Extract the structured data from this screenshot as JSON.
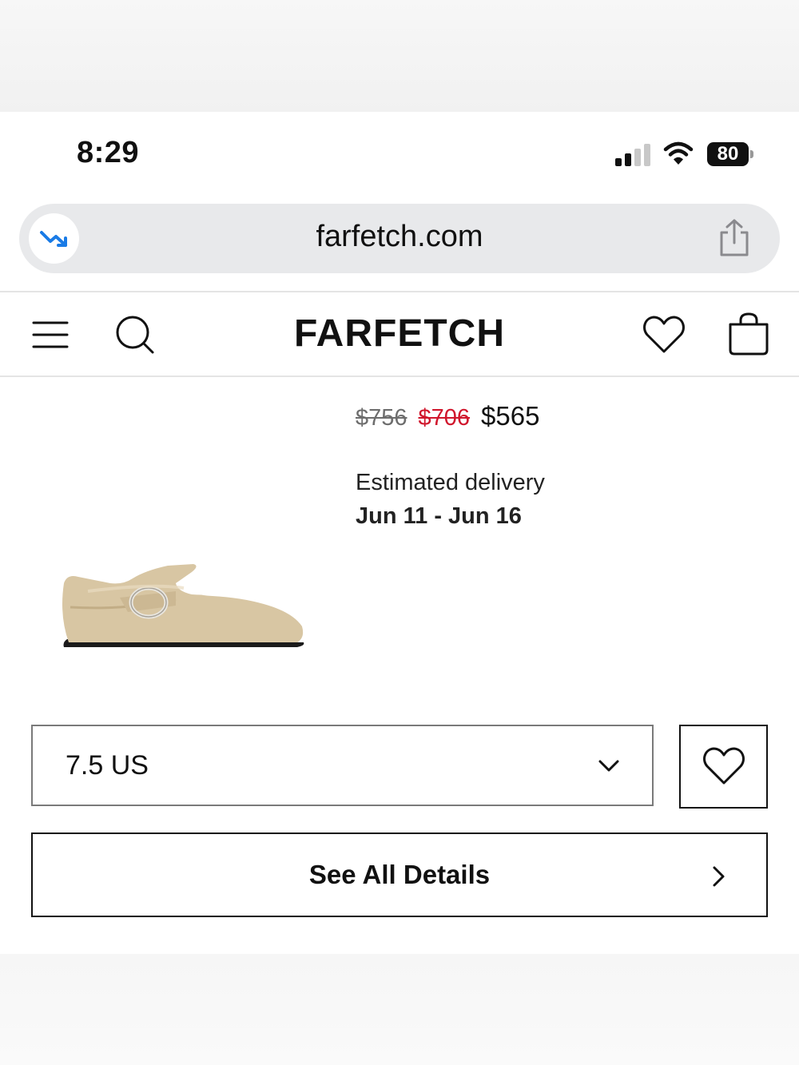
{
  "status_bar": {
    "time": "8:29",
    "battery": "80"
  },
  "browser": {
    "url": "farfetch.com",
    "badge_icon": "trending-down-icon",
    "share_icon": "share-icon"
  },
  "header": {
    "logo": "FARFETCH",
    "icons": [
      "menu-icon",
      "search-icon",
      "heart-icon",
      "bag-icon"
    ]
  },
  "product": {
    "price_original": "$756",
    "price_previous": "$706",
    "price_current": "$565",
    "delivery_label": "Estimated delivery",
    "delivery_dates": "Jun 11 - Jun 16"
  },
  "size_selector": {
    "value": "7.5 US"
  },
  "details_button": {
    "label": "See All Details"
  },
  "colors": {
    "accent_red": "#d0162c",
    "url_icon_blue": "#1a7be6",
    "text": "#111111"
  }
}
